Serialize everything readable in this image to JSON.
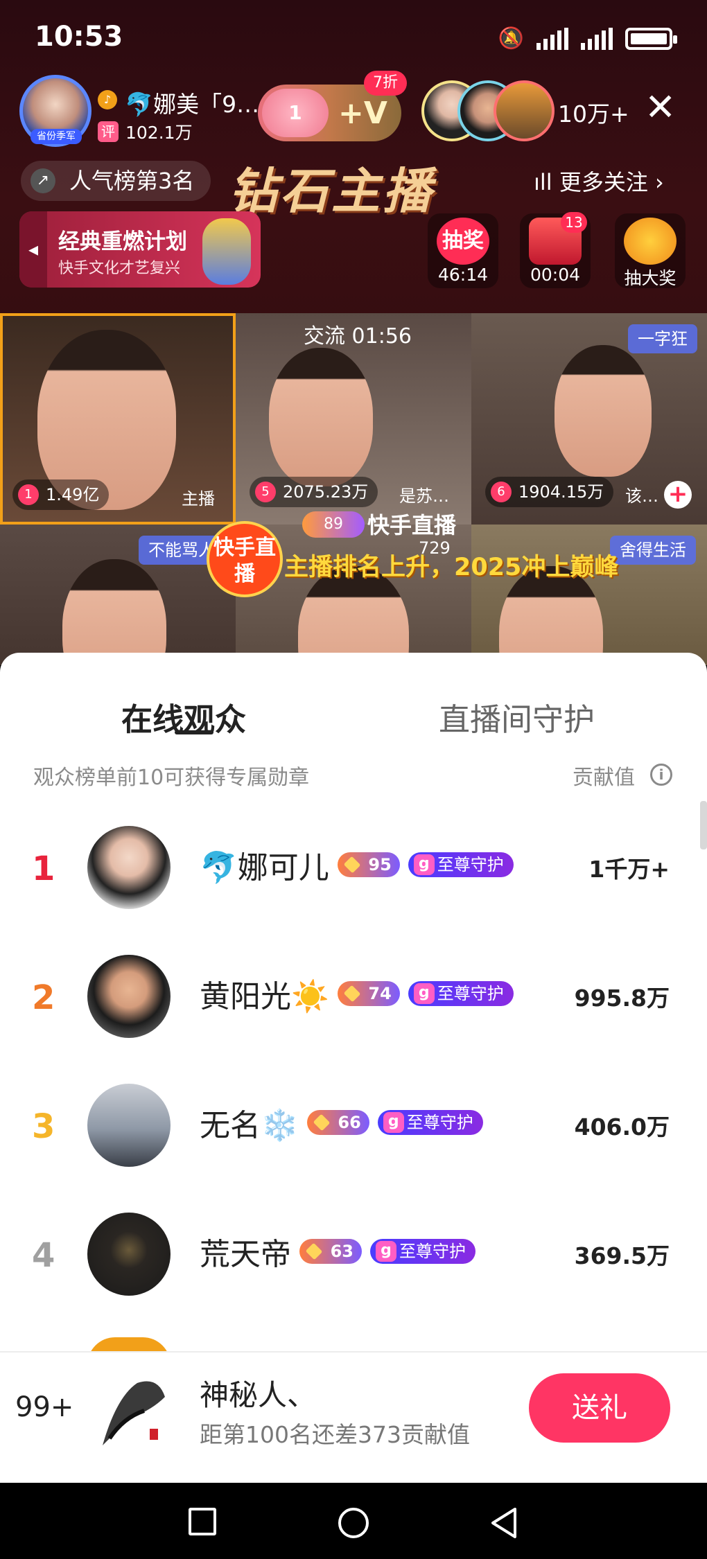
{
  "status_bar": {
    "time": "10:53"
  },
  "header": {
    "host_name": "🐬娜美「9…",
    "host_tag": "省份季军",
    "host_gold": "♪",
    "host_fans_badge": "评",
    "host_fans": "102.1万",
    "fan_club_level": "1",
    "fan_club_plus": "+V",
    "discount": "7折",
    "viewer_count": "10万+",
    "close": "✕",
    "popularity_rank": "人气榜第3名",
    "diamond_host": "钻石主播",
    "more_follow": "ıll 更多关注 ›"
  },
  "banner": {
    "title": "经典重燃计划",
    "subtitle": "快手文化才艺复兴",
    "arrow": "◂"
  },
  "activities": [
    {
      "icon_text": "抽奖",
      "label": "46:14"
    },
    {
      "icon_text": "",
      "label": "00:04",
      "badge": "13"
    },
    {
      "icon_text": "",
      "label": "抽大奖"
    }
  ],
  "video_grid": {
    "timer": "交流 01:56",
    "cells": [
      {
        "score_rank": "1",
        "score": "1.49亿",
        "label": "主播"
      },
      {
        "score_rank": "5",
        "score": "2075.23万",
        "label": "是苏…"
      },
      {
        "score_rank": "6",
        "score": "1904.15万",
        "label": "该…",
        "tag": "一字狂"
      }
    ],
    "second_row_tags": [
      "不能骂人",
      "729",
      "舍得生活"
    ],
    "ks_badge": "快手直播",
    "level": "89",
    "ks_live": "快手直播",
    "promo": "主播排名上升，2025冲上巅峰"
  },
  "sheet": {
    "tabs": [
      "在线观众",
      "直播间守护"
    ],
    "hint": "观众榜单前10可获得专属勋章",
    "contrib_label": "贡献值",
    "info": "i",
    "rows": [
      {
        "rank": "1",
        "name": "🐬娜可儿",
        "level": "95",
        "guard": "至尊守护",
        "value": "1千万+",
        "rank_color": "#e8233c"
      },
      {
        "rank": "2",
        "name": "黄阳光☀️",
        "level": "74",
        "guard": "至尊守护",
        "value": "995.8万",
        "rank_color": "#f07a2a"
      },
      {
        "rank": "3",
        "name": "无名❄️",
        "level": "66",
        "guard": "至尊守护",
        "value": "406.0万",
        "rank_color": "#f5b52a"
      },
      {
        "rank": "4",
        "name": "荒天帝",
        "level": "63",
        "guard": "至尊守护",
        "value": "369.5万",
        "rank_color": "#a0a0a0"
      }
    ]
  },
  "me": {
    "rank": "99+",
    "name": "神秘人、",
    "sub": "距第100名还差373贡献值",
    "gift_button": "送礼"
  }
}
